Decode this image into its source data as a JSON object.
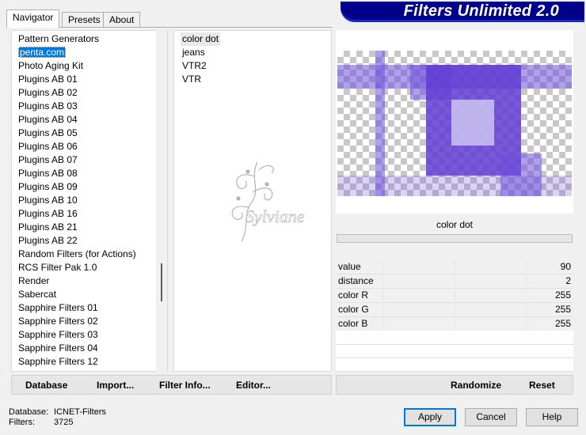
{
  "tabs": [
    {
      "label": "Navigator",
      "active": true
    },
    {
      "label": "Presets",
      "active": false
    },
    {
      "label": "About",
      "active": false
    }
  ],
  "banner": {
    "title": "Filters Unlimited 2.0"
  },
  "categories": [
    "Pattern Generators",
    "penta.com",
    "Photo Aging Kit",
    "Plugins AB 01",
    "Plugins AB 02",
    "Plugins AB 03",
    "Plugins AB 04",
    "Plugins AB 05",
    "Plugins AB 06",
    "Plugins AB 07",
    "Plugins AB 08",
    "Plugins AB 09",
    "Plugins AB 10",
    "Plugins AB 16",
    "Plugins AB 21",
    "Plugins AB 22",
    "Random Filters (for Actions)",
    "RCS Filter Pak 1.0",
    "Render",
    "Sabercat",
    "Sapphire Filters 01",
    "Sapphire Filters 02",
    "Sapphire Filters 03",
    "Sapphire Filters 04",
    "Sapphire Filters 12"
  ],
  "selected_category": "penta.com",
  "filters": [
    "color dot",
    "jeans",
    "VTR2",
    "VTR"
  ],
  "selected_filter": "color dot",
  "preview": {
    "filter_name": "color dot"
  },
  "params": [
    {
      "label": "value",
      "value": "90"
    },
    {
      "label": "distance",
      "value": "2"
    },
    {
      "label": "color R",
      "value": "255"
    },
    {
      "label": "color G",
      "value": "255"
    },
    {
      "label": "color B",
      "value": "255"
    }
  ],
  "left_buttons": {
    "database": "Database",
    "import": "Import...",
    "filter_info": "Filter Info...",
    "editor": "Editor..."
  },
  "right_buttons": {
    "randomize": "Randomize",
    "reset": "Reset"
  },
  "status": {
    "database_label": "Database:",
    "database_value": "ICNET-Filters",
    "filters_label": "Filters:",
    "filters_value": "3725"
  },
  "dialog_buttons": {
    "apply": "Apply",
    "cancel": "Cancel",
    "help": "Help"
  },
  "watermark": {
    "text": "Sylviane"
  },
  "colors": {
    "banner": "#00008b",
    "selection": "#0078d7",
    "preview_fill": "#6e50dc",
    "default_button_border": "#0078d7"
  },
  "icons": {
    "watermark_logo": "floral-swirl"
  }
}
